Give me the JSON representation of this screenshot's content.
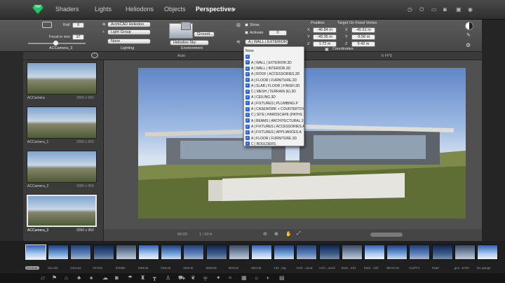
{
  "app": {
    "logo_icon": "gem-icon"
  },
  "tabs": [
    {
      "label": "Shaders"
    },
    {
      "label": "Lights"
    },
    {
      "label": "Heliodons"
    },
    {
      "label": "Objects"
    },
    {
      "label": "Perspectives"
    }
  ],
  "toolbar": {
    "roll_label": "Roll",
    "roll_value": "0",
    "focal_label": "Focal in mm",
    "focal_value": "37",
    "camera_name": "ACCamera_3",
    "heliodon": "ArchiCAD Heliodon",
    "light_group": "Light Group",
    "lighting_none": "None",
    "lighting_label": "Lighting",
    "ground_label": "Ground...",
    "sky_label": "Heliodon Sky",
    "environment_label": "Environment",
    "show_label": "Show",
    "activate_label": "Activate",
    "activate_value": "0",
    "layer_selected": "A | WALL | EXTERIOR",
    "position_label": "Position",
    "target_label": "Target On Fixed Vertex",
    "x_pos": "-46.84 m",
    "y_pos": "-49.35 m",
    "z_pos": "1.72 m",
    "x_target": "-45.51 m",
    "y_target": "-5.56 m",
    "z_target": "5.42 m",
    "coordinates_label": "Coordinates",
    "axis_x": "X",
    "axis_y": "Y",
    "axis_z": "Z"
  },
  "subbar": {
    "auto_label": "Auto",
    "fps_label": "6 FPS"
  },
  "cameras": [
    {
      "name": "ACCamera",
      "dims": "2000 x 950"
    },
    {
      "name": "ACCamera_1",
      "dims": "2000 x 950"
    },
    {
      "name": "ACCamera_2",
      "dims": "2000 x 950"
    },
    {
      "name": "ACCamera_3",
      "dims": "2000 x 950"
    }
  ],
  "layers_dropdown": {
    "items": [
      {
        "label": "None",
        "checked": false
      },
      {
        "label": "",
        "checked": true
      },
      {
        "label": "A | WALL | EXTERIOR.3D",
        "checked": true
      },
      {
        "label": "A | WALL | INTERIOR.3D",
        "checked": true
      },
      {
        "label": "A | ROOF | ACCESSORIES.3D",
        "checked": true
      },
      {
        "label": "A | FLOOR | FURNITURE.2D",
        "checked": true
      },
      {
        "label": "A | SLAB | FLOOR | FINISH.3D",
        "checked": true
      },
      {
        "label": "C | MESH | TERRAIN (E).3D",
        "checked": true
      },
      {
        "label": "A | CEILING.3D",
        "checked": true
      },
      {
        "label": "A | FIXTURES | PLUMBING.P",
        "checked": true
      },
      {
        "label": "A | CASEWORK + COUNTERTOI",
        "checked": true
      },
      {
        "label": "C | SITE | HARDSCAPE (PATHS",
        "checked": true
      },
      {
        "label": "A | BEAMS | ARCHITECTURAL.3",
        "checked": true
      },
      {
        "label": "A | FIXTURES | ACCESSORIES.A",
        "checked": true
      },
      {
        "label": "A | FIXTURES | APPLIANCES.A",
        "checked": true
      },
      {
        "label": "A | FLOOR | FURNITURE.3D",
        "checked": true
      },
      {
        "label": "C | BOULDERS",
        "checked": true
      }
    ]
  },
  "viewport": {
    "zoom_a": "00:00",
    "zoom_b": "1 / 60 fr"
  },
  "filmstrip": [
    {
      "label": "01Clear"
    },
    {
      "label": "01Lclai"
    },
    {
      "label": "01Ccas"
    },
    {
      "label": "01Tcal"
    },
    {
      "label": "02Sdie"
    },
    {
      "label": "04Ncal"
    },
    {
      "label": "04Scal"
    },
    {
      "label": "05Scal"
    },
    {
      "label": "05Ncak"
    },
    {
      "label": "06Hcal"
    },
    {
      "label": "06Ccal"
    },
    {
      "label": "142 ..ing"
    },
    {
      "label": "Arch ..ound"
    },
    {
      "label": "Arch ..ound"
    },
    {
      "label": "back ..ed1"
    },
    {
      "label": "back ..ed2"
    },
    {
      "label": "BEACH1"
    },
    {
      "label": "CLIFF1"
    },
    {
      "label": "Fade"
    },
    {
      "label": "gus ..5720"
    },
    {
      "label": "lac gauge"
    }
  ],
  "colors": {
    "accent": "#2b63d8",
    "selection": "#e8e8e8"
  }
}
